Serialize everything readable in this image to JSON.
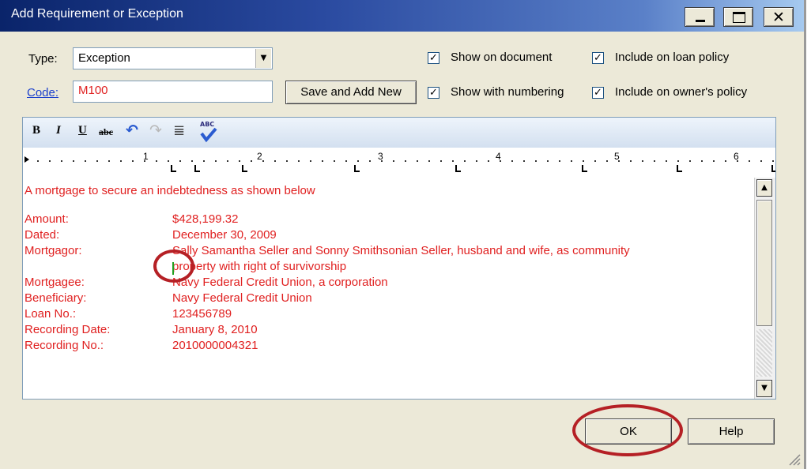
{
  "window": {
    "title": "Add Requirement or Exception"
  },
  "form": {
    "type_label": "Type:",
    "type_value": "Exception",
    "code_label": "Code:",
    "code_value": "M100",
    "save_add_new": "Save and Add New"
  },
  "checkboxes": {
    "show_on_document": "Show on document",
    "show_with_numbering": "Show with numbering",
    "include_loan_policy": "Include on loan policy",
    "include_owner_policy": "Include on owner's policy",
    "checked_mark": "✓"
  },
  "toolbar": {
    "bold": "B",
    "italic": "I",
    "underline": "U",
    "strike": "abc",
    "undo": "↶",
    "redo": "↷",
    "list": "≣",
    "spell": "ABC"
  },
  "ruler": {
    "marks": [
      "1",
      "2",
      "3",
      "4",
      "5",
      "6"
    ]
  },
  "document": {
    "intro": "A mortgage to secure an indebtedness as shown below",
    "rows": [
      {
        "label": "Amount:",
        "value": "$428,199.32"
      },
      {
        "label": "Dated:",
        "value": "December 30, 2009"
      },
      {
        "label": "Mortgagor:",
        "value": "Sally Samantha Seller and Sonny Smithsonian Seller, husband and wife, as community"
      },
      {
        "label": "",
        "value": "property with right of survivorship"
      },
      {
        "label": "Mortgagee:",
        "value": "Navy Federal Credit Union, a corporation"
      },
      {
        "label": "Beneficiary:",
        "value": "Navy Federal Credit Union"
      },
      {
        "label": "Loan No.:",
        "value": "123456789"
      },
      {
        "label": "Recording Date:",
        "value": "January 8, 2010"
      },
      {
        "label": "Recording No.:",
        "value": "2010000004321"
      }
    ]
  },
  "buttons": {
    "ok": "OK",
    "help": "Help"
  }
}
